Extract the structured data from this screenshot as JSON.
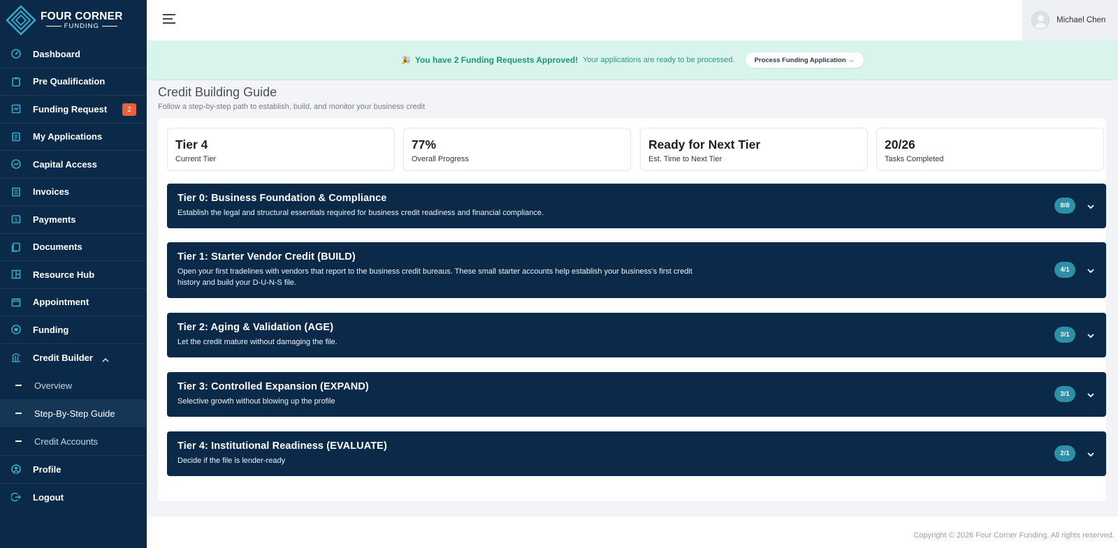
{
  "brand": {
    "title": "FOUR CORNER",
    "subtitle": "FUNDING"
  },
  "sidebar": {
    "items": [
      {
        "label": "Dashboard",
        "icon": "dashboard-icon"
      },
      {
        "label": "Pre Qualification",
        "icon": "clipboard-icon"
      },
      {
        "label": "Funding Request",
        "icon": "funding-request-icon",
        "badge": "2"
      },
      {
        "label": "My Applications",
        "icon": "applications-icon"
      },
      {
        "label": "Capital Access",
        "icon": "chart-icon"
      },
      {
        "label": "Invoices",
        "icon": "invoice-icon"
      },
      {
        "label": "Payments",
        "icon": "payments-icon"
      },
      {
        "label": "Documents",
        "icon": "documents-icon"
      },
      {
        "label": "Resource Hub",
        "icon": "resource-hub-icon"
      },
      {
        "label": "Appointment",
        "icon": "calendar-icon"
      },
      {
        "label": "Funding",
        "icon": "coin-icon"
      },
      {
        "label": "Credit Builder",
        "icon": "bank-icon"
      }
    ],
    "credit_builder_sub": [
      {
        "label": "Overview"
      },
      {
        "label": "Step-By-Step Guide",
        "active": true
      },
      {
        "label": "Credit Accounts"
      }
    ],
    "bottom_items": [
      {
        "label": "Profile",
        "icon": "profile-icon"
      },
      {
        "label": "Logout",
        "icon": "logout-icon"
      }
    ]
  },
  "topbar": {
    "user_name": "Michael Chen"
  },
  "banner": {
    "emoji": "🎉",
    "strong": "You have 2 Funding Requests Approved!",
    "message": "Your applications are ready to be processed.",
    "button": "Process Funding Application →"
  },
  "page": {
    "title": "Credit Building Guide",
    "subtitle": "Follow a step-by-step path to establish, build, and monitor your business credit"
  },
  "stats": [
    {
      "value": "Tier 4",
      "caption": "Current Tier"
    },
    {
      "value": "77%",
      "caption": "Overall Progress"
    },
    {
      "value": "Ready for Next Tier",
      "caption": "Est. Time to Next Tier"
    },
    {
      "value": "20/26",
      "caption": "Tasks Completed"
    }
  ],
  "tiers": [
    {
      "title": "Tier 0: Business Foundation & Compliance",
      "desc": "Establish the legal and structural essentials required for business credit readiness and financial compliance.",
      "badge": "8/8"
    },
    {
      "title": "Tier 1: Starter Vendor Credit (BUILD)",
      "desc": "Open your first tradelines with vendors that report to the business credit bureaus. These small starter accounts help establish your business's first credit history and build your D-U-N-S file.",
      "badge": "4/1"
    },
    {
      "title": "Tier 2: Aging & Validation (AGE)",
      "desc": "Let the credit mature without damaging the file.",
      "badge": "3/1"
    },
    {
      "title": "Tier 3: Controlled Expansion (EXPAND)",
      "desc": "Selective growth without blowing up the profile",
      "badge": "3/1"
    },
    {
      "title": "Tier 4: Institutional Readiness (EVALUATE)",
      "desc": "Decide if the file is lender-ready",
      "badge": "2/1"
    }
  ],
  "footer": "Copyright © 2026 Four Corner Funding. All rights reserved.",
  "colors": {
    "sidebar": "#0b2a4a",
    "banner": "#d9f4ec",
    "accent": "#2e8fa8",
    "badge": "#e8613c",
    "banner_text": "#1a9a6e"
  }
}
